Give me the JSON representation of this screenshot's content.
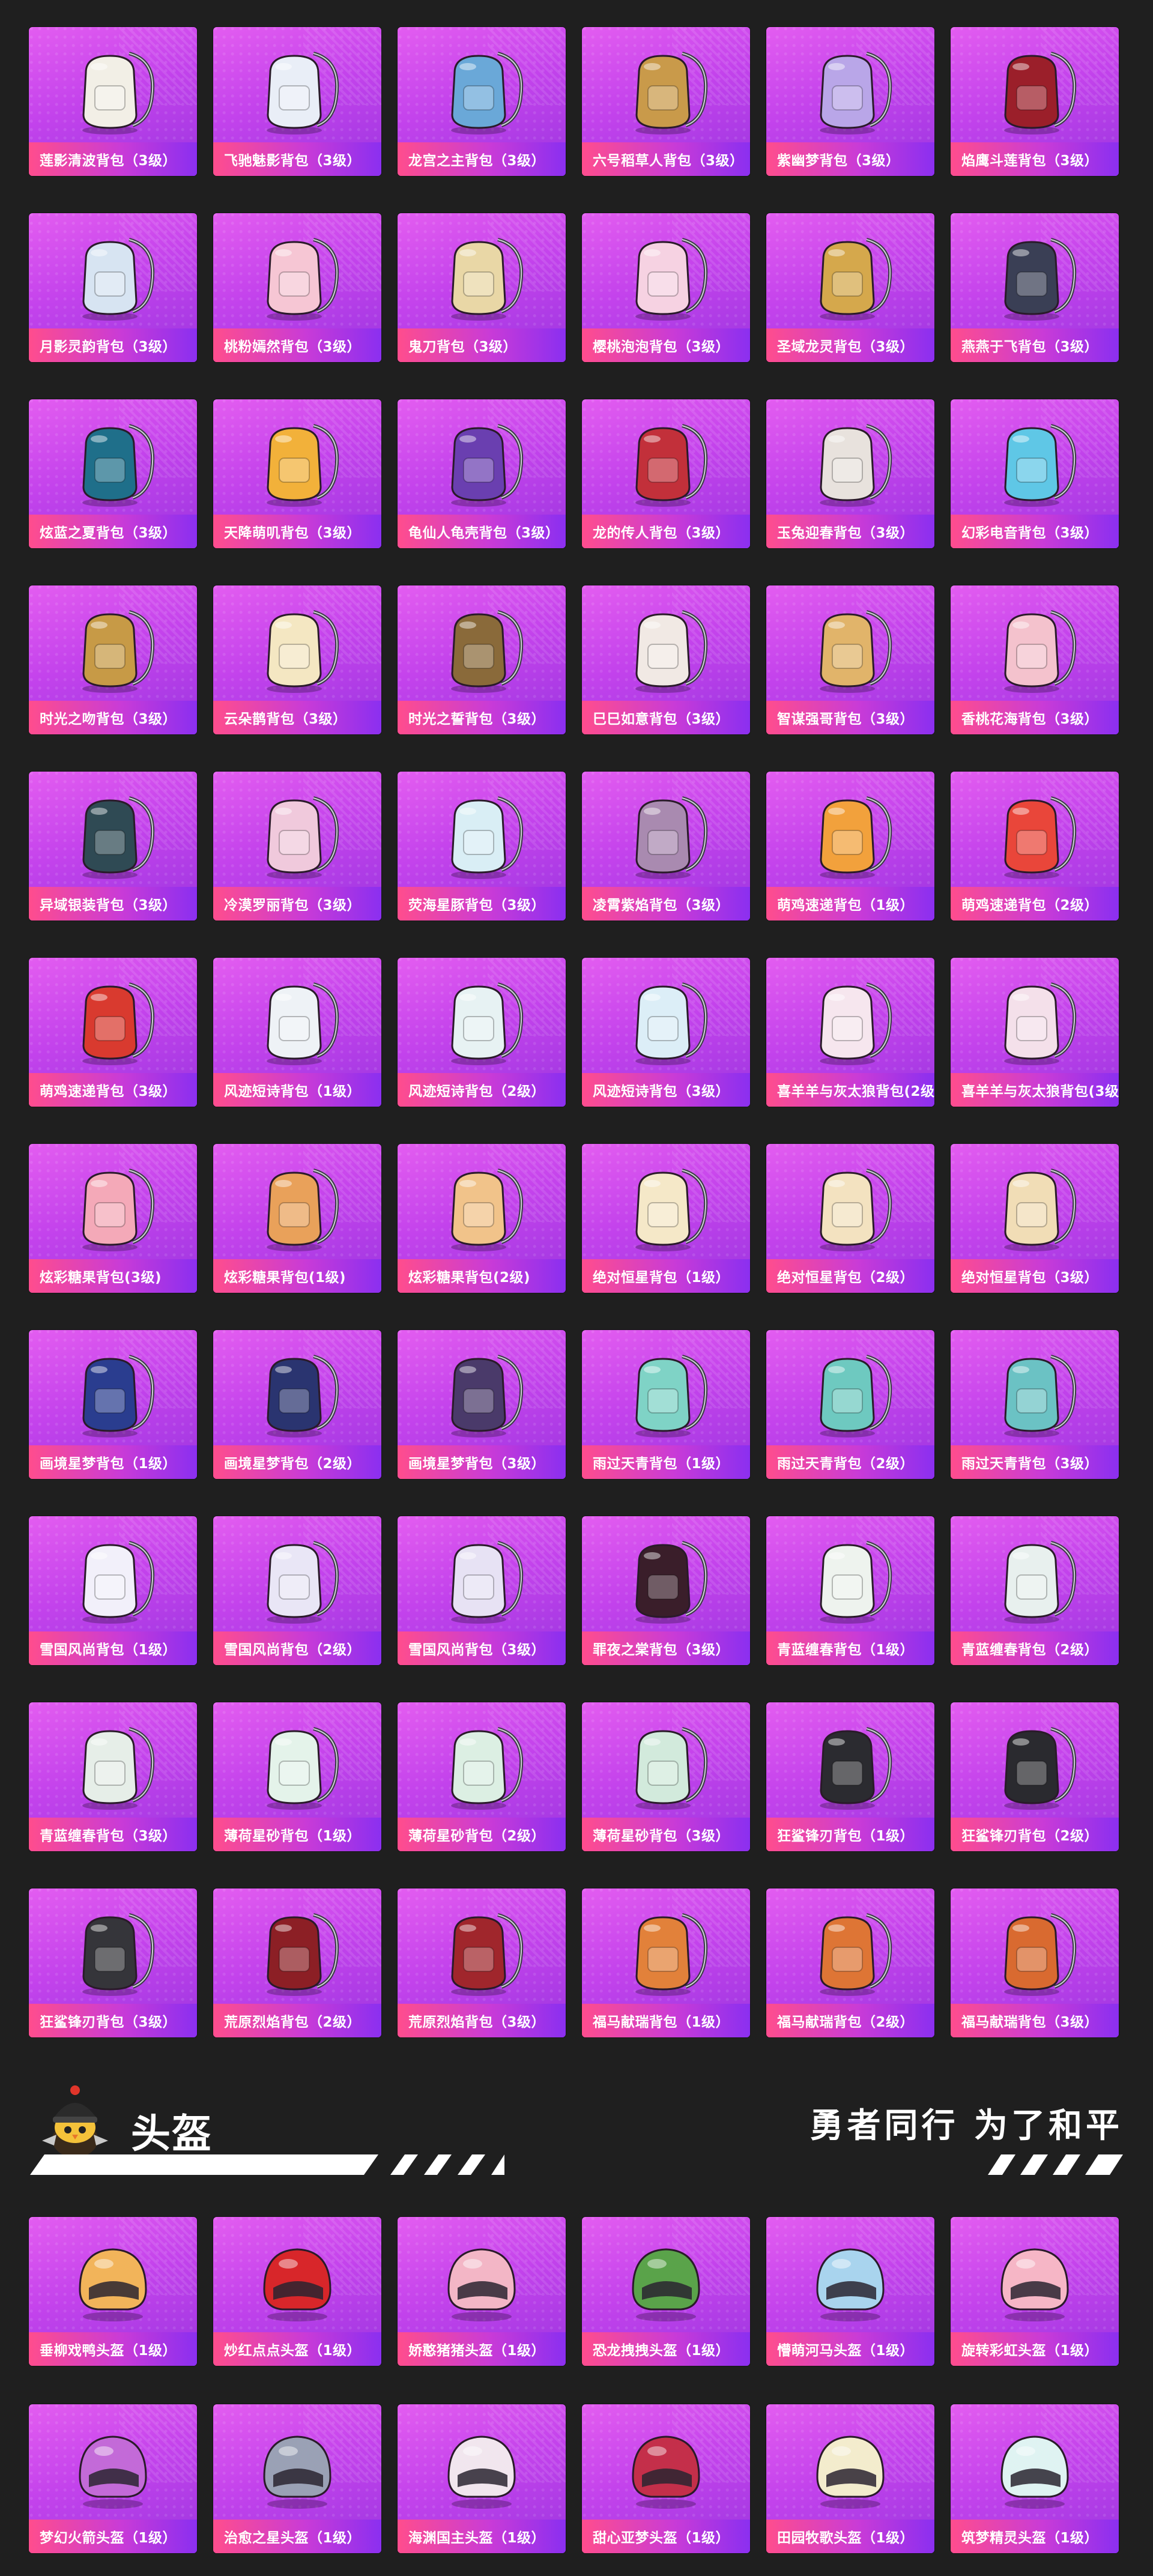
{
  "backpacks": [
    {
      "label": "莲影清波背包（3级）",
      "icon": "white-lotus-backpack-icon",
      "color": "#f2efe6"
    },
    {
      "label": "飞驰魅影背包（3级）",
      "icon": "blue-white-racer-backpack-icon",
      "color": "#e9eef7"
    },
    {
      "label": "龙宫之主背包（3级）",
      "icon": "ornate-dragon-palace-backpack-icon",
      "color": "#6aa8d8"
    },
    {
      "label": "六号稻草人背包（3级）",
      "icon": "scarecrow-backpack-icon",
      "color": "#c99a4a"
    },
    {
      "label": "紫幽梦背包（3级）",
      "icon": "purple-rabbit-backpack-icon",
      "color": "#b9a6e8"
    },
    {
      "label": "焰鹰斗莲背包（3级）",
      "icon": "red-black-mech-backpack-icon",
      "color": "#9b1f2a"
    },
    {
      "label": "月影灵韵背包（3级）",
      "icon": "moon-spirit-backpack-icon",
      "color": "#d7e4f2"
    },
    {
      "label": "桃粉嫣然背包（3级）",
      "icon": "pink-dress-backpack-icon",
      "color": "#f6c6d4"
    },
    {
      "label": "鬼刀背包（3级）",
      "icon": "winged-blade-backpack-icon",
      "color": "#e9d7a6"
    },
    {
      "label": "樱桃泡泡背包（3级）",
      "icon": "pink-bow-backpack-icon",
      "color": "#f6d2e2"
    },
    {
      "label": "圣域龙灵背包（3级）",
      "icon": "golden-dragon-shield-backpack-icon",
      "color": "#d5a84c"
    },
    {
      "label": "燕燕于飞背包（3级）",
      "icon": "swallow-backpack-icon",
      "color": "#3a3f55"
    },
    {
      "label": "炫蓝之夏背包（3级）",
      "icon": "blue-tech-backpack-icon",
      "color": "#1f6f8a"
    },
    {
      "label": "天降萌叽背包（3级）",
      "icon": "yellow-chick-backpack-icon",
      "color": "#f2b13a"
    },
    {
      "label": "龟仙人龟壳背包（3级）",
      "icon": "turtle-shell-backpack-icon",
      "color": "#6a3fb0"
    },
    {
      "label": "龙的传人背包（3级）",
      "icon": "red-gold-dragon-backpack-icon",
      "color": "#c2303a"
    },
    {
      "label": "玉兔迎春背包（3级）",
      "icon": "white-red-rabbit-backpack-icon",
      "color": "#e8e2dd"
    },
    {
      "label": "幻彩电音背包（3级）",
      "icon": "neon-speaker-backpack-icon",
      "color": "#5fc7e6"
    },
    {
      "label": "时光之吻背包（3级）",
      "icon": "golden-clock-backpack-icon",
      "color": "#c79a46"
    },
    {
      "label": "云朵鹊背包（3级）",
      "icon": "cloud-bird-backpack-icon",
      "color": "#f4e7c2"
    },
    {
      "label": "时光之誓背包（3级）",
      "icon": "compass-gear-backpack-icon",
      "color": "#8a6a3a"
    },
    {
      "label": "巳巳如意背包（3级）",
      "icon": "snake-charm-backpack-icon",
      "color": "#f1e9e4"
    },
    {
      "label": "智谋强哥背包（3级）",
      "icon": "bear-goggles-backpack-icon",
      "color": "#e1b46a"
    },
    {
      "label": "香桃花海背包（3级）",
      "icon": "peach-blossom-backpack-icon",
      "color": "#f4c2cd"
    },
    {
      "label": "异域银装背包（3级）",
      "icon": "tactical-pack-backpack-icon",
      "color": "#2f4a54"
    },
    {
      "label": "冷漠罗丽背包（3级）",
      "icon": "pink-heart-frame-backpack-icon",
      "color": "#f0c9dc"
    },
    {
      "label": "荧海星豚背包（3级）",
      "icon": "crystal-dolphin-backpack-icon",
      "color": "#d9eef5"
    },
    {
      "label": "凌霄紫焰背包（3级）",
      "icon": "purple-flame-frame-backpack-icon",
      "color": "#a98ab0"
    },
    {
      "label": "萌鸡速递背包（1级）",
      "icon": "chick-lv1-backpack-icon",
      "color": "#f2a13c"
    },
    {
      "label": "萌鸡速递背包（2级）",
      "icon": "chick-lv2-backpack-icon",
      "color": "#e9463a"
    },
    {
      "label": "萌鸡速递背包（3级）",
      "icon": "chick-lv3-backpack-icon",
      "color": "#d93a2f"
    },
    {
      "label": "风迹短诗背包（1级）",
      "icon": "poem-bag-lv1-backpack-icon",
      "color": "#eef2f6"
    },
    {
      "label": "风迹短诗背包（2级）",
      "icon": "poem-bag-lv2-backpack-icon",
      "color": "#e7f2f3"
    },
    {
      "label": "风迹短诗背包（3级）",
      "icon": "poem-bag-lv3-backpack-icon",
      "color": "#dceef7"
    },
    {
      "label": "喜羊羊与灰太狼背包(2级)",
      "icon": "sheep-lv2-backpack-icon",
      "color": "#f6e6ee"
    },
    {
      "label": "喜羊羊与灰太狼背包(3级)",
      "icon": "sheep-lv3-backpack-icon",
      "color": "#f4e0ea"
    },
    {
      "label": "炫彩糖果背包(3级)",
      "icon": "donut-lv3-backpack-icon",
      "color": "#f4a9b8"
    },
    {
      "label": "炫彩糖果背包(1级)",
      "icon": "donut-lv1-backpack-icon",
      "color": "#e9a15a"
    },
    {
      "label": "炫彩糖果背包(2级)",
      "icon": "donut-lv2-backpack-icon",
      "color": "#f1c38a"
    },
    {
      "label": "绝对恒星背包（1级）",
      "icon": "popcorn-lv1-backpack-icon",
      "color": "#f5e8c8"
    },
    {
      "label": "绝对恒星背包（2级）",
      "icon": "popcorn-lv2-backpack-icon",
      "color": "#f3e2c0"
    },
    {
      "label": "绝对恒星背包（3级）",
      "icon": "popcorn-lv3-backpack-icon",
      "color": "#f1ddb6"
    },
    {
      "label": "画境星梦背包（1级）",
      "icon": "starry-book-lv1-backpack-icon",
      "color": "#2a3d8f"
    },
    {
      "label": "画境星梦背包（2级）",
      "icon": "starry-book-lv2-backpack-icon",
      "color": "#2a3470"
    },
    {
      "label": "画境星梦背包（3级）",
      "icon": "starry-frame-lv3-backpack-icon",
      "color": "#4a3a6a"
    },
    {
      "label": "雨过天青背包（1级）",
      "icon": "jade-lv1-backpack-icon",
      "color": "#7fd3c6"
    },
    {
      "label": "雨过天青背包（2级）",
      "icon": "jade-lv2-backpack-icon",
      "color": "#6ec9c0"
    },
    {
      "label": "雨过天青背包（3级）",
      "icon": "jade-lv3-backpack-icon",
      "color": "#6bc2c4"
    },
    {
      "label": "雪国风尚背包（1级）",
      "icon": "snow-bunny-lv1-backpack-icon",
      "color": "#f2f0fa"
    },
    {
      "label": "雪国风尚背包（2级）",
      "icon": "snow-bunny-lv2-backpack-icon",
      "color": "#e9e6f6"
    },
    {
      "label": "雪国风尚背包（3级）",
      "icon": "snow-bunny-lv3-backpack-icon",
      "color": "#e7e2f4"
    },
    {
      "label": "罪夜之棠背包（3级）",
      "icon": "dark-rose-backpack-icon",
      "color": "#3a1e2a"
    },
    {
      "label": "青蓝缠春背包（1级）",
      "icon": "blue-pattern-lv1-backpack-icon",
      "color": "#eef3ee"
    },
    {
      "label": "青蓝缠春背包（2级）",
      "icon": "blue-pattern-lv2-backpack-icon",
      "color": "#e8f0ee"
    },
    {
      "label": "青蓝缠春背包（3级）",
      "icon": "blue-pattern-lv3-backpack-icon",
      "color": "#e6eee8"
    },
    {
      "label": "薄荷星砂背包（1级）",
      "icon": "mint-lv1-backpack-icon",
      "color": "#e4f3ea"
    },
    {
      "label": "薄荷星砂背包（2级）",
      "icon": "mint-lv2-backpack-icon",
      "color": "#dcefe3"
    },
    {
      "label": "薄荷星砂背包（3级）",
      "icon": "mint-lv3-backpack-icon",
      "color": "#d2eadc"
    },
    {
      "label": "狂鲨锋刃背包（1级）",
      "icon": "shark-lv1-backpack-icon",
      "color": "#2b2b30"
    },
    {
      "label": "狂鲨锋刃背包（2级）",
      "icon": "shark-lv2-backpack-icon",
      "color": "#2a2a2f"
    },
    {
      "label": "狂鲨锋刃背包（3级）",
      "icon": "shark-lv3-backpack-icon",
      "color": "#35353a"
    },
    {
      "label": "荒原烈焰背包（2级）",
      "icon": "flame-mech-lv2-backpack-icon",
      "color": "#8c1f25"
    },
    {
      "label": "荒原烈焰背包（3级）",
      "icon": "flame-mech-lv3-backpack-icon",
      "color": "#a0262c"
    },
    {
      "label": "福马献瑞背包（1级）",
      "icon": "horse-lv1-backpack-icon",
      "color": "#e2813a"
    },
    {
      "label": "福马献瑞背包（2级）",
      "icon": "horse-lv2-backpack-icon",
      "color": "#de7535"
    },
    {
      "label": "福马献瑞背包（3级）",
      "icon": "horse-lv3-backpack-icon",
      "color": "#d96a30"
    }
  ],
  "helmet_section": {
    "title": "头盔",
    "slogan": "勇者同行 为了和平",
    "mascot_icon": "chick-helmet-mascot-icon"
  },
  "helmets": [
    {
      "label": "垂柳戏鸭头盔（1级）",
      "icon": "duck-helmet-icon",
      "color": "#f2b45a"
    },
    {
      "label": "炒红点点头盔（1级）",
      "icon": "red-dot-helmet-icon",
      "color": "#d8262a"
    },
    {
      "label": "娇憨猪猪头盔（1级）",
      "icon": "pig-helmet-icon",
      "color": "#f3b6c6"
    },
    {
      "label": "恐龙拽拽头盔（1级）",
      "icon": "dino-helmet-icon",
      "color": "#5aa34a"
    },
    {
      "label": "懵萌河马头盔（1级）",
      "icon": "hippo-helmet-icon",
      "color": "#a9d4ee"
    },
    {
      "label": "旋转彩虹头盔（1级）",
      "icon": "rainbow-helmet-icon",
      "color": "#f6b6c6"
    },
    {
      "label": "梦幻火箭头盔（1级）",
      "icon": "rocket-helmet-icon",
      "color": "#c36ad8"
    },
    {
      "label": "治愈之星头盔（1级）",
      "icon": "star-visor-helmet-icon",
      "color": "#9aa1b5"
    },
    {
      "label": "海渊国主头盔（1级）",
      "icon": "sea-king-helmet-icon",
      "color": "#f1e6ee"
    },
    {
      "label": "甜心亚梦头盔（1级）",
      "icon": "sweetheart-helmet-icon",
      "color": "#c42f4a"
    },
    {
      "label": "田园牧歌头盔（1级）",
      "icon": "pastoral-helmet-icon",
      "color": "#f3eccd"
    },
    {
      "label": "筑梦精灵头盔（1级）",
      "icon": "sprite-helmet-icon",
      "color": "#dff3f2"
    }
  ]
}
